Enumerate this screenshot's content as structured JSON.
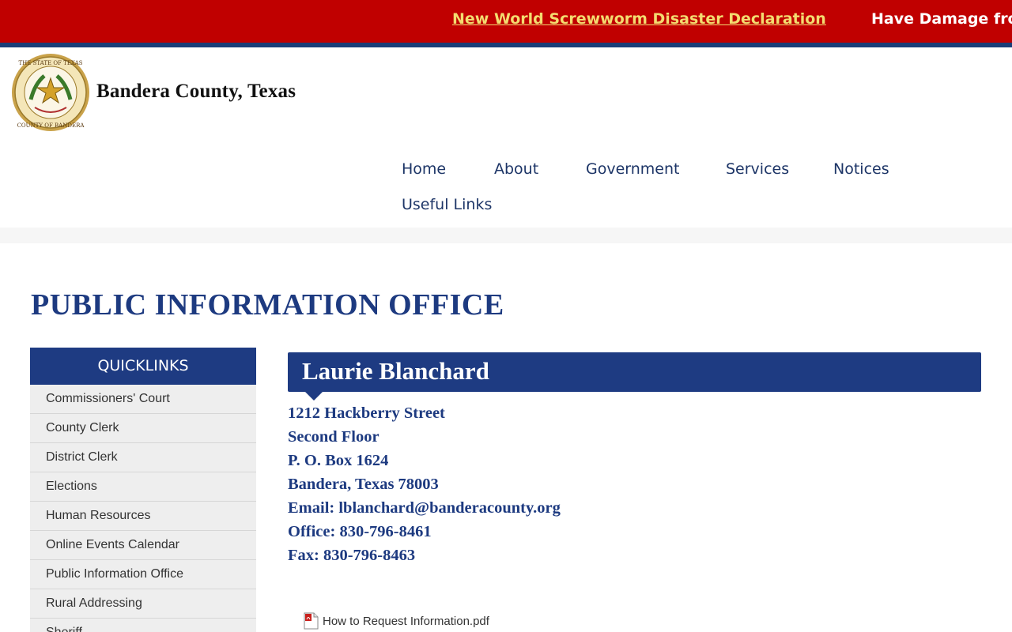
{
  "alert": {
    "link_text": "New World Screwworm Disaster Declaration",
    "scrolling_text": "Have Damage fror",
    "colors": {
      "background": "#c00000",
      "link": "#f3dc70",
      "stripe": "#1a3e78"
    }
  },
  "header": {
    "site_title": "Bandera County, Texas",
    "seal_icon": "county-seal-icon"
  },
  "nav": {
    "items": [
      {
        "label": "Home"
      },
      {
        "label": "About"
      },
      {
        "label": "Government"
      },
      {
        "label": "Services"
      },
      {
        "label": "Notices"
      },
      {
        "label": "Useful Links"
      }
    ]
  },
  "page": {
    "title": "PUBLIC INFORMATION OFFICE"
  },
  "quicklinks": {
    "heading": "QUICKLINKS",
    "items": [
      {
        "label": "Commissioners' Court"
      },
      {
        "label": "County Clerk"
      },
      {
        "label": "District Clerk"
      },
      {
        "label": "Elections"
      },
      {
        "label": "Human Resources"
      },
      {
        "label": "Online Events Calendar"
      },
      {
        "label": "Public Information Office"
      },
      {
        "label": "Rural Addressing"
      },
      {
        "label": "Sheriff"
      }
    ]
  },
  "contact": {
    "name": "Laurie Blanchard",
    "street": "1212 Hackberry Street",
    "floor": "Second Floor",
    "po_box": "P. O. Box 1624",
    "city": "Bandera, Texas 78003",
    "email_label": "Email: ",
    "email": "lblanchard@banderacounty.org",
    "office": "Office: 830-796-8461",
    "fax": "Fax: 830-796-8463"
  },
  "documents": [
    {
      "label": "How to Request Information.pdf",
      "icon": "pdf-icon"
    }
  ],
  "colors": {
    "brand_blue": "#1e3b82",
    "text_blue": "#1d3a80"
  }
}
